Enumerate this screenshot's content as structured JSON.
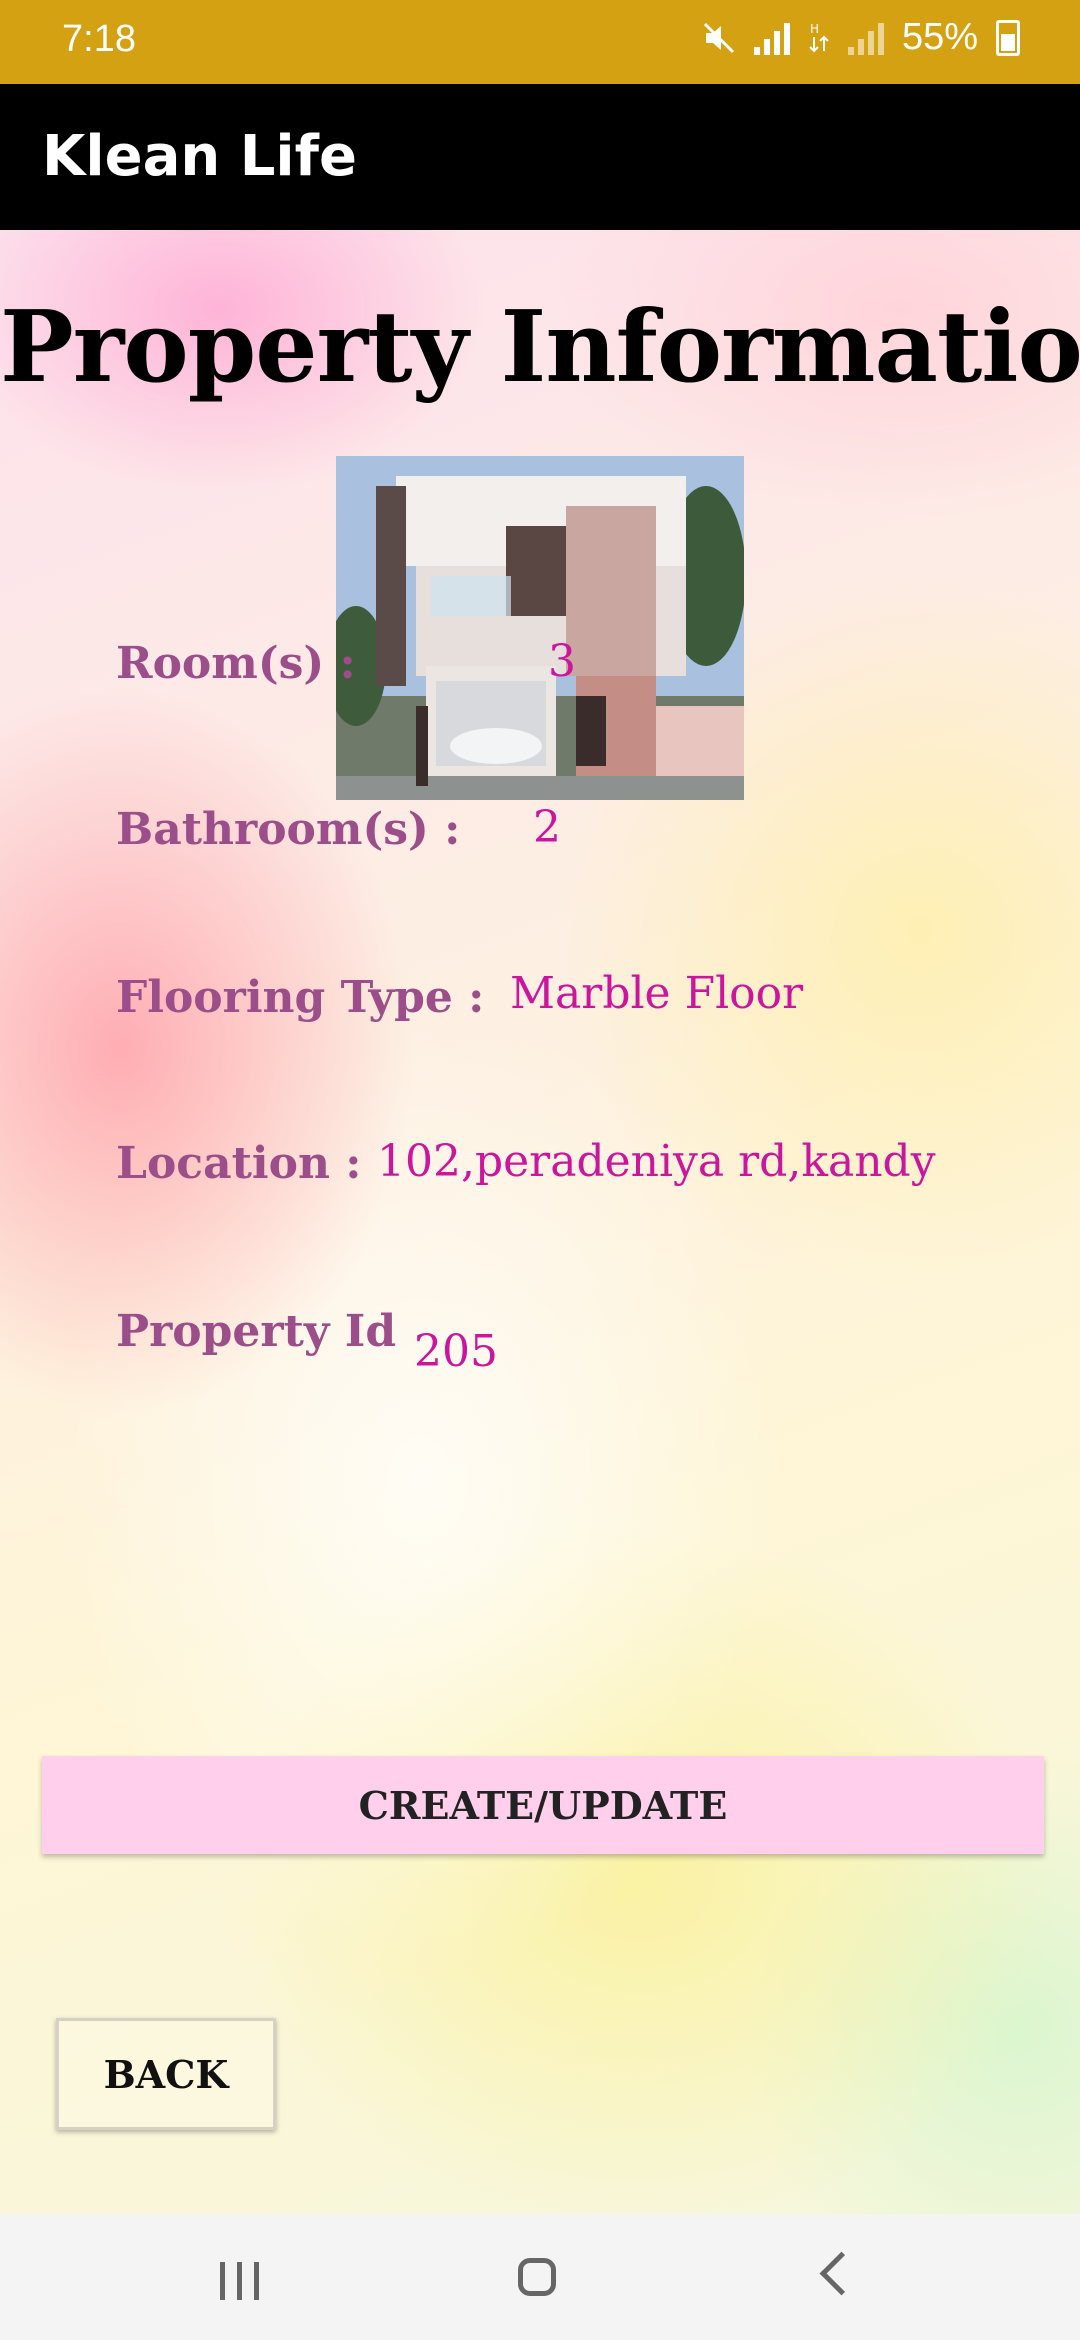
{
  "status_bar": {
    "time": "7:18",
    "battery": "55%"
  },
  "app_bar": {
    "title": "Klean Life"
  },
  "page": {
    "title": "Property Information"
  },
  "property": {
    "rooms_label": "Room(s) :",
    "rooms_value": "3",
    "bathrooms_label": "Bathroom(s) :",
    "bathrooms_value": "2",
    "flooring_label": "Flooring Type :",
    "flooring_value": "Marble Floor",
    "location_label": "Location :",
    "location_value": "102,peradeniya rd,kandy",
    "id_label": "Property Id",
    "id_value": "205"
  },
  "buttons": {
    "create_update": "CREATE/UPDATE",
    "back": "BACK"
  },
  "colors": {
    "status_bar": "#d4a112",
    "app_bar": "#000000",
    "label": "#9b4e8a",
    "value": "#c9169c",
    "create_button": "#ffcfeb"
  }
}
